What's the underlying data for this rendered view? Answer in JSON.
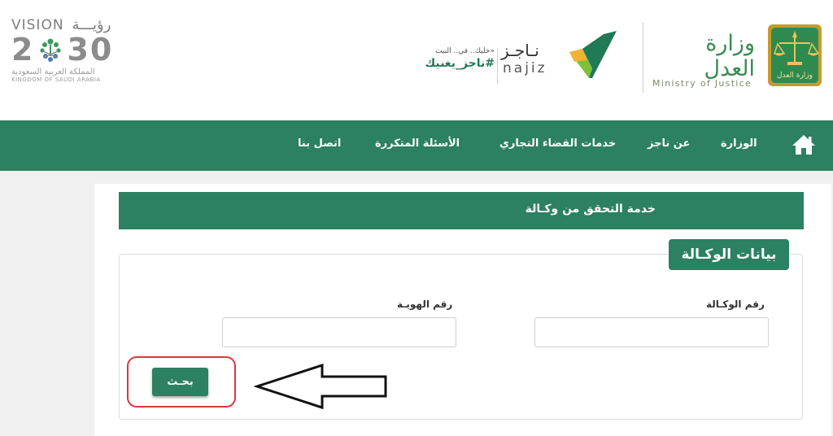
{
  "header": {
    "vision": {
      "label": "VISION",
      "label_ar": "رؤيـــة",
      "year_left": "2",
      "year_right": "30",
      "kingdom_ar": "المملكة العربية السعودية",
      "kingdom_en": "KINGDOM OF SAUDI ARABIA"
    },
    "slogan": {
      "small": "«خليك.. في.. البيت",
      "main": "#ناجز_يغنيك"
    },
    "najiz": {
      "name_ar": "نـاجـز",
      "name_en": "najiz",
      "color": "#1f7a55",
      "accent": "#7fbf3a"
    },
    "ministry": {
      "name_ar": "وزارة العدل",
      "name_en": "Ministry of Justice",
      "emblem_text": "وزارة العدل"
    }
  },
  "nav": {
    "home_icon": "home-icon",
    "items": [
      {
        "label": "الوزارة"
      },
      {
        "label": "عن ناجز"
      },
      {
        "label": "خدمات القضاء التجاري"
      },
      {
        "label": "الأسئلة المتكررة"
      },
      {
        "label": "اتصل بنا"
      }
    ]
  },
  "service": {
    "title": "خدمة التحقق من وكـالة"
  },
  "form": {
    "legend": "بيانات الوكـالة",
    "agency_number": {
      "label": "رقم الوكـالة",
      "value": ""
    },
    "id_number": {
      "label": "رقم الهويـة",
      "value": ""
    },
    "search_button": "بحـث"
  },
  "colors": {
    "brand_green": "#2b8161",
    "highlight_red": "#d9383b",
    "page_bg": "#f0f0f0"
  },
  "annotation": {
    "arrow_icon": "left-arrow-icon"
  }
}
